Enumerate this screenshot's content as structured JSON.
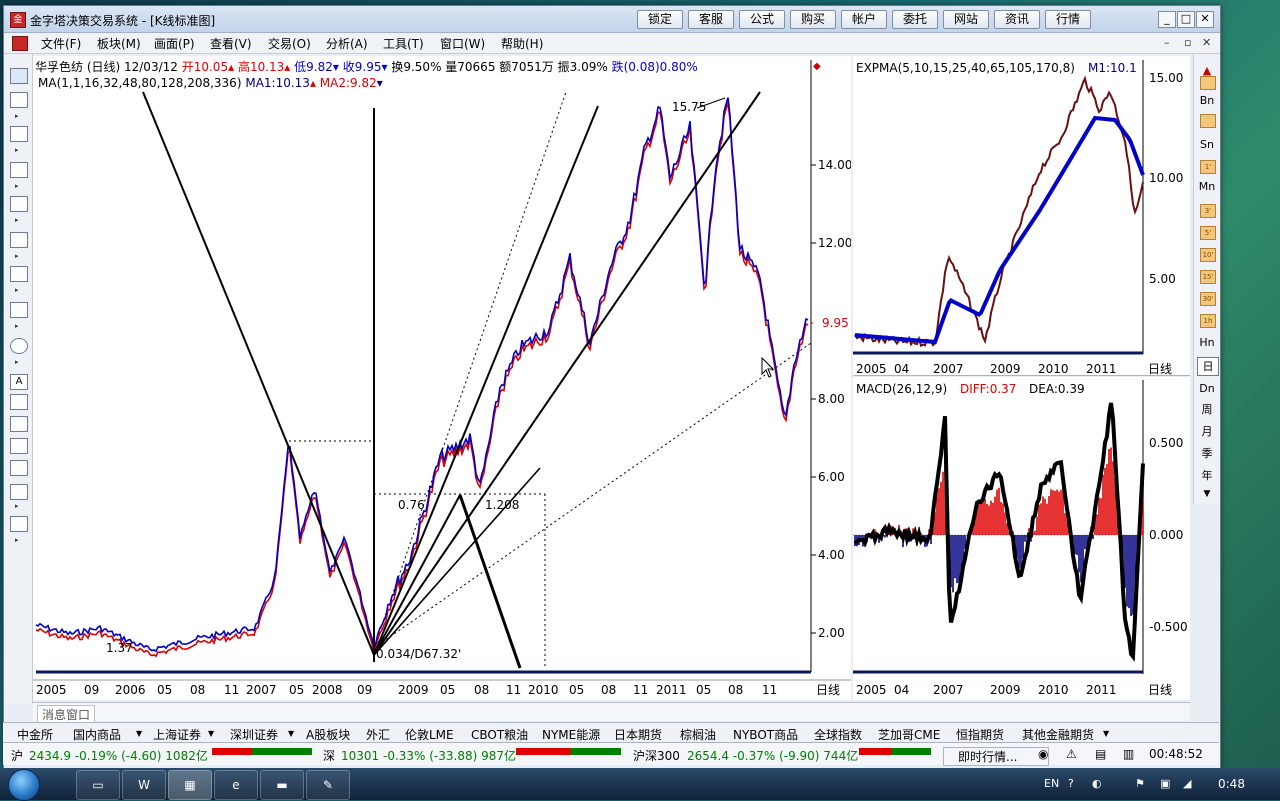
{
  "window": {
    "title": "金字塔决策交易系统 - [K线标准图]",
    "top_buttons": [
      "锁定",
      "客服",
      "公式",
      "购买",
      "帐户",
      "委托",
      "网站",
      "资讯",
      "行情"
    ],
    "controls": {
      "minimize": "_",
      "maximize": "□",
      "close": "✕"
    }
  },
  "menu": [
    "文件(F)",
    "板块(M)",
    "画面(P)",
    "查看(V)",
    "交易(O)",
    "分析(A)",
    "工具(T)",
    "窗口(W)",
    "帮助(H)"
  ],
  "right_periods": [
    "Bn",
    "Sn",
    "Mn",
    "Hn",
    "日",
    "Dn",
    "周",
    "月",
    "季",
    "年"
  ],
  "right_minutes": [
    "1'",
    "3'",
    "5'",
    "10'",
    "15'",
    "30'",
    "1h"
  ],
  "main_chart": {
    "stock": "华孚色纺 (日线) 12/03/12",
    "open": "开10.05",
    "high": "高10.13",
    "low": "低9.82",
    "close": "收9.95",
    "stats": "换9.50% 量70665 额7051万 振3.09%",
    "change": "跌(0.08)0.80%",
    "ma_title": "MA(1,1,16,32,48,80,128,208,336)",
    "ma1": "MA1:10.13",
    "ma2": "MA2:9.82",
    "yaxis": [
      "14.00",
      "12.00",
      "10.00",
      "8.00",
      "6.00",
      "4.00",
      "2.00"
    ],
    "price_tag": "9.95",
    "xaxis": [
      "2005",
      "09",
      "2006",
      "05",
      "08",
      "11",
      "2007",
      "05",
      "2008",
      "09",
      "2009",
      "05",
      "08",
      "11",
      "2010",
      "05",
      "08",
      "11",
      "2011",
      "05",
      "08",
      "11"
    ],
    "period_label": "日线",
    "annotations": {
      "peak": "15.75",
      "low_left": "1.37",
      "low_pivot": "0.034/D67.32'",
      "fib1": "0.76",
      "fib2": "1.208"
    }
  },
  "expma_chart": {
    "title": "EXPMA(5,10,15,25,40,65,105,170,8)",
    "m1": "M1:10.1",
    "yaxis": [
      "15.00",
      "10.00",
      "5.00"
    ],
    "xaxis": [
      "2005",
      "04",
      "2007",
      "2009",
      "2010",
      "2011"
    ],
    "period_label": "日线"
  },
  "macd_chart": {
    "title": "MACD(26,12,9)",
    "diff": "DIFF:0.37",
    "dea": "DEA:0.39",
    "yaxis": [
      "0.500",
      "0.000",
      "-0.500"
    ],
    "xaxis": [
      "2005",
      "04",
      "2007",
      "2009",
      "2010",
      "2011"
    ],
    "period_label": "日线"
  },
  "message_window": "消息窗口",
  "tabs": [
    "中金所",
    "国内商品",
    "上海证券",
    "深圳证券",
    "A股板块",
    "外汇",
    "伦敦LME",
    "CBOT粮油",
    "NYME能源",
    "日本期货",
    "棕榈油",
    "NYBOT商品",
    "全球指数",
    "芝加哥CME",
    "恒指期货",
    "其他金融期货"
  ],
  "status": {
    "sh_label": "沪",
    "sh_value": "2434.9 -0.19% (-4.60) 1082亿",
    "sz_label": "深",
    "sz_value": "10301 -0.33% (-33.88) 987亿",
    "hs300_label": "沪深300",
    "hs300_value": "2654.4 -0.37% (-9.90) 744亿",
    "realtime": "即时行情...",
    "time": "00:48:52"
  },
  "taskbar": {
    "lang": "EN",
    "clock": "0:48"
  },
  "colors": {
    "up": "#e00000",
    "down": "#0000c8",
    "background": "#ffffff"
  }
}
